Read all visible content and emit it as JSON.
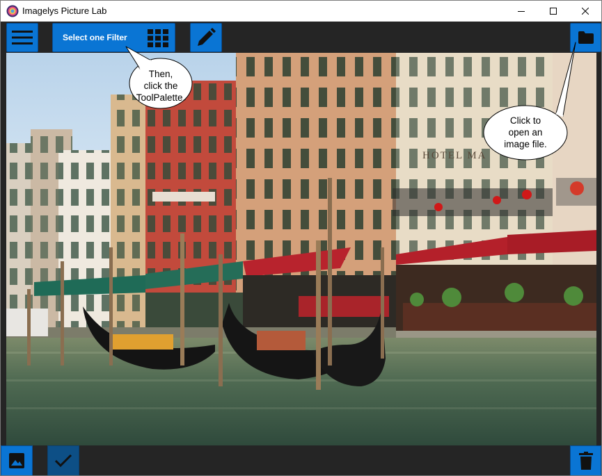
{
  "window": {
    "title": "Imagelys Picture Lab",
    "controls": [
      "minimize",
      "maximize",
      "close"
    ]
  },
  "toolbar": {
    "menu_icon": "hamburger-menu-icon",
    "filter_button_label": "Select one Filter",
    "filter_icon": "grid-icon",
    "edit_icon": "pencil-icon",
    "open_icon": "folder-icon"
  },
  "canvas": {
    "sign_text": "HOTEL MA"
  },
  "callouts": {
    "toolpalette_lines": [
      "Then,",
      "click the",
      "ToolPalette."
    ],
    "open_file_lines": [
      "Click to",
      "open an",
      "image file."
    ]
  },
  "bottombar": {
    "image_icon": "image-icon",
    "check_icon": "check-icon",
    "delete_icon": "trash-icon"
  },
  "colors": {
    "accent": "#0a75d4",
    "background": "#252525"
  }
}
